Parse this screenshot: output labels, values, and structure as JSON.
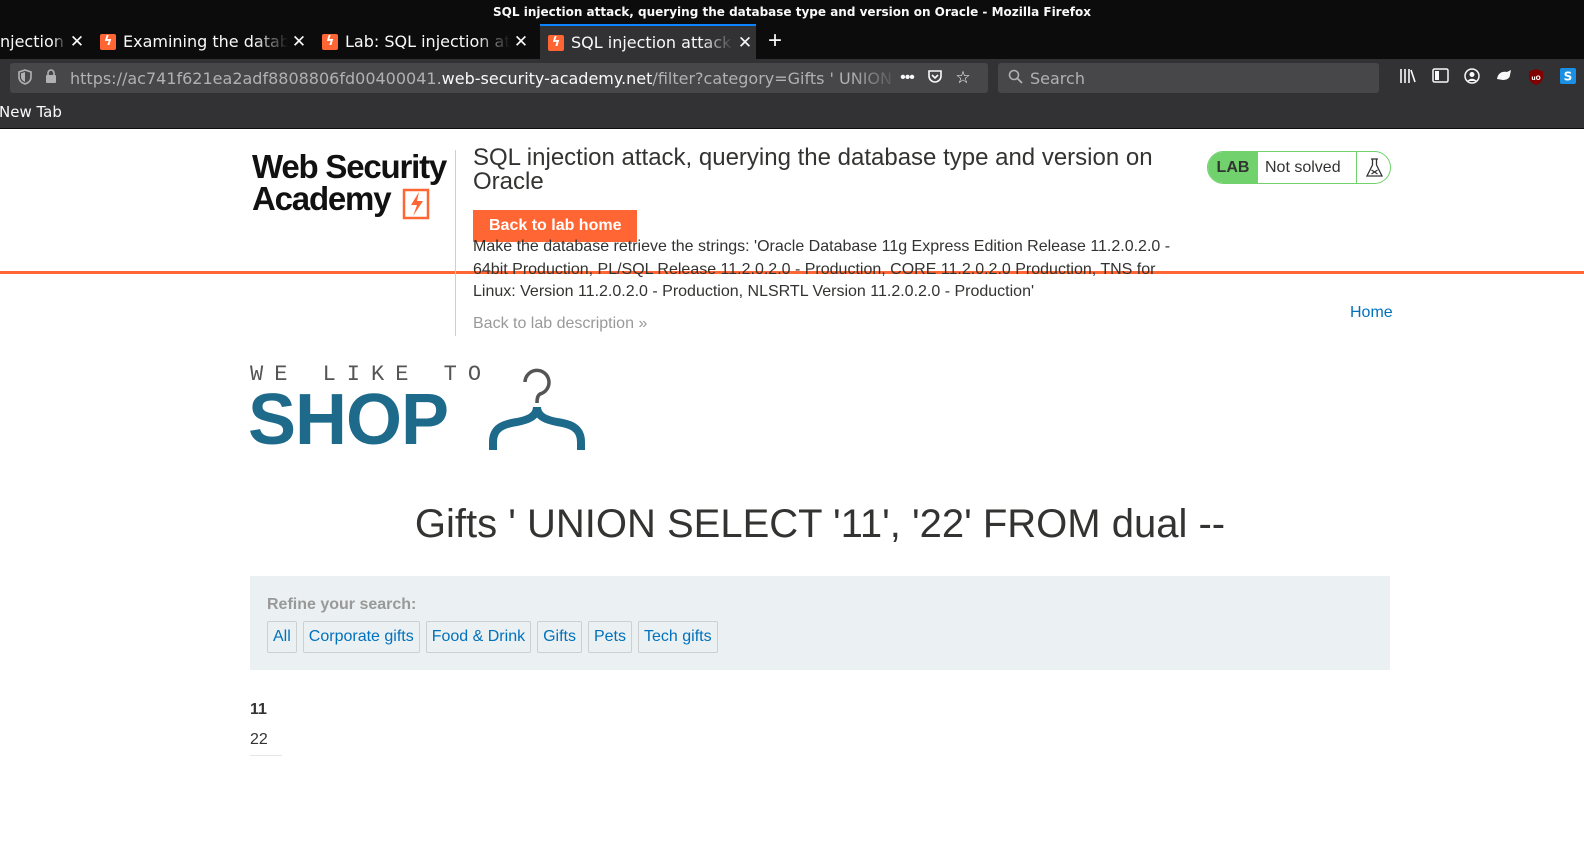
{
  "window": {
    "title": "SQL injection attack, querying the database type and version on Oracle - Mozilla Firefox"
  },
  "tabs": [
    {
      "label": "njection?"
    },
    {
      "label": "Examining the database"
    },
    {
      "label": "Lab: SQL injection attack"
    },
    {
      "label": "SQL injection attack, querying"
    }
  ],
  "urlbar": {
    "prefix": "https://ac741f621ea2adf8808806fd00400041.",
    "host": "web-security-academy.net",
    "path": "/filter?category=Gifts ' UNION SELECT"
  },
  "search": {
    "placeholder": "Search"
  },
  "bookmarks": [
    {
      "label": "New Tab"
    }
  ],
  "header": {
    "logo_line1": "Web Security",
    "logo_line2": "Academy",
    "lab_title": "SQL injection attack, querying the database type and version on Oracle",
    "back_home": "Back to lab home",
    "description": "Make the database retrieve the strings: 'Oracle Database 11g Express Edition Release 11.2.0.2.0 - 64bit Production, PL/SQL Release 11.2.0.2.0 - Production, CORE 11.2.0.2.0 Production, TNS for Linux: Version 11.2.0.2.0 - Production, NLSRTL Version 11.2.0.2.0 - Production'",
    "back_description": "Back to lab description",
    "lab_badge": "LAB",
    "status": "Not solved",
    "home_link": "Home"
  },
  "shop_logo": {
    "tagline": "WE LIKE TO",
    "word": "SHOP"
  },
  "main": {
    "heading": "Gifts ' UNION SELECT '11', '22' FROM dual --",
    "refine_label": "Refine your search:",
    "filters": [
      "All",
      "Corporate gifts",
      "Food & Drink",
      "Gifts",
      "Pets",
      "Tech gifts"
    ],
    "results": {
      "header": "11",
      "row": "22"
    }
  },
  "colors": {
    "accent": "#ff6633",
    "link": "#0071bc",
    "solved_green": "#70d16d",
    "shop_blue": "#1d6a8b"
  },
  "icons": [
    "shield-icon",
    "lock-icon",
    "more-icon",
    "pocket-icon",
    "star-icon",
    "search-icon",
    "library-icon",
    "sidebar-icon",
    "account-icon",
    "extension-icon",
    "ublock-icon",
    "s-icon",
    "flask-icon"
  ]
}
